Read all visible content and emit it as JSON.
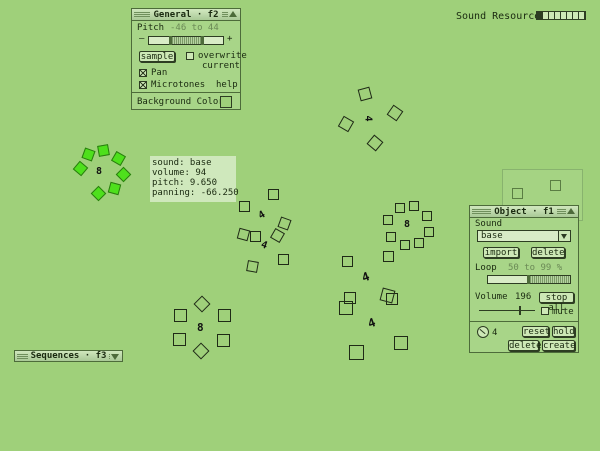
{
  "sound_resources": {
    "label": "Sound Resources",
    "segments": 8,
    "filled": 1
  },
  "general_panel": {
    "title": "General · f2",
    "pitch_label": "Pitch",
    "pitch_range": "-46 to 44",
    "minus": "–",
    "plus": "+",
    "sample_button": "sample",
    "overwrite_label": "overwrite",
    "current_label": "current",
    "pan_label": "Pan",
    "pan_checked": true,
    "microtones_label": "Microtones",
    "microtones_checked": true,
    "help_label": "help",
    "bg_color_label": "Background Color",
    "bg_color": "#9fd07a"
  },
  "info_tooltip": {
    "sound": "sound: base",
    "volume": "volume: 94",
    "pitch": "pitch: 9.650",
    "panning": "panning: -66.250"
  },
  "object_panel": {
    "title": "Object · f1",
    "sound_label": "Sound",
    "sound_value": "base",
    "import_button": "import",
    "delete_button": "delete",
    "loop_label": "Loop",
    "loop_range": "50 to 99 %",
    "volume_label": "Volume",
    "volume_value": "196",
    "stop_all_button": "stop all",
    "mute_label": "mute",
    "count": "4",
    "reset_button": "reset",
    "hold_button": "hold",
    "delete2_button": "delete",
    "create_button": "create"
  },
  "sequences_panel": {
    "title": "Sequences · f3"
  },
  "colors": {
    "background": "#9fd07a",
    "panel": "#a8d588",
    "highlight": "#4ee01c",
    "border": "#4d6b3a"
  }
}
